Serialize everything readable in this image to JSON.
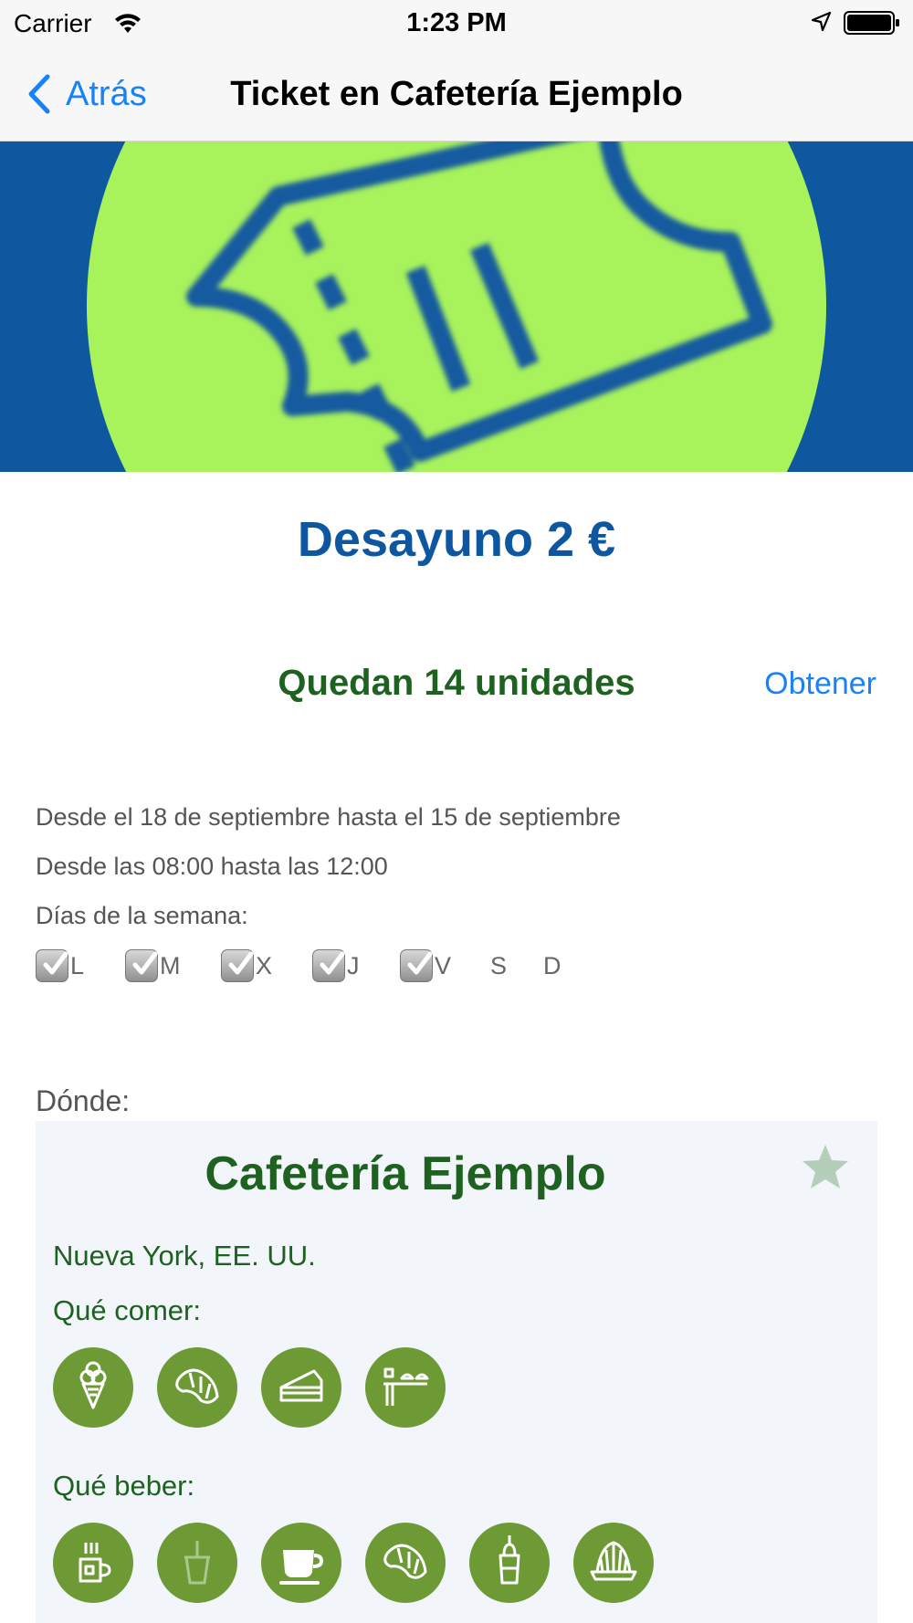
{
  "status_bar": {
    "carrier": "Carrier",
    "time": "1:23 PM",
    "icons": [
      "wifi-icon",
      "location-arrow-icon",
      "battery-icon"
    ]
  },
  "nav": {
    "back_label": "Atrás",
    "title": "Ticket en Cafetería Ejemplo"
  },
  "banner": {
    "icon": "ticket-icon",
    "background_color": "#0f58a0",
    "circle_color": "#a8f25c"
  },
  "ticket": {
    "title": "Desayuno 2 €",
    "units_left": "Quedan 14 unidades",
    "obtain_label": "Obtener",
    "date_range": "Desde el 18 de septiembre hasta el 15 de septiembre",
    "time_range": "Desde las 08:00 hasta las 12:00",
    "weekdays_label": "Días de la semana:",
    "days": [
      {
        "label": "L",
        "checked": true
      },
      {
        "label": "M",
        "checked": true
      },
      {
        "label": "X",
        "checked": true
      },
      {
        "label": "J",
        "checked": true
      },
      {
        "label": "V",
        "checked": true
      },
      {
        "label": "S",
        "checked": false
      },
      {
        "label": "D",
        "checked": false
      }
    ]
  },
  "where": {
    "label": "Dónde:",
    "place_name": "Cafetería Ejemplo",
    "location": "Nueva York, EE. UU.",
    "favorite_icon": "star-icon",
    "eat_label": "Qué comer:",
    "eat_icons": [
      "ice-cream-icon",
      "croissant-icon",
      "cake-slice-icon",
      "tapas-icon"
    ],
    "drink_label": "Qué beber:",
    "drink_icons": [
      "hot-drink-icon",
      "iced-drink-icon",
      "coffee-cup-icon",
      "croissant-icon",
      "smoothie-icon",
      "juicer-icon"
    ]
  },
  "colors": {
    "accent_blue": "#1a82f7",
    "title_blue": "#0e57a0",
    "green_text": "#1f6120",
    "icon_green": "#6e9a36"
  }
}
